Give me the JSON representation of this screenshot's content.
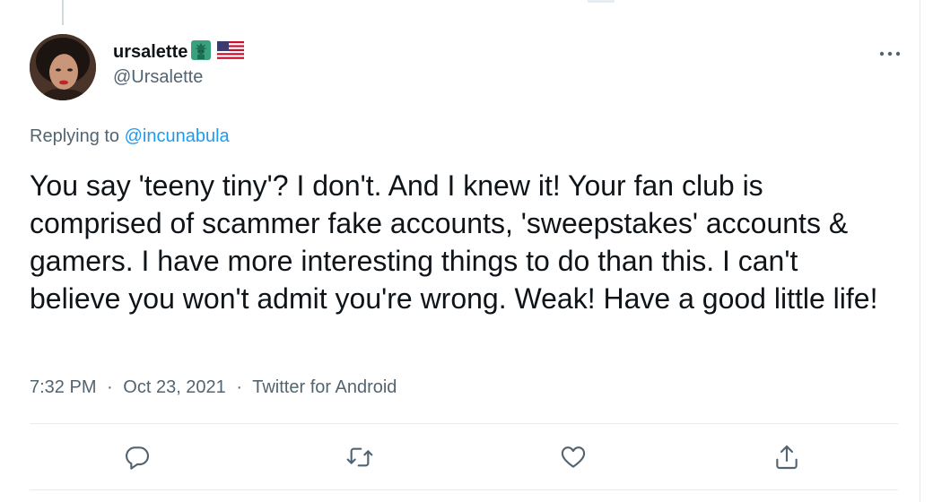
{
  "author": {
    "display_name": "ursalette",
    "handle": "@Ursalette",
    "badges": [
      "statue-of-liberty-emoji",
      "us-flag-emoji"
    ]
  },
  "reply": {
    "prefix": "Replying to",
    "mention": "@incunabula"
  },
  "tweet": {
    "text": "You say 'teeny tiny'? I don't. And I knew it! Your fan club is comprised of scammer fake accounts, 'sweepstakes' accounts & gamers. I have more interesting things to do than this. I can't believe you won't admit you're wrong. Weak! Have a good little life!"
  },
  "meta": {
    "time": "7:32 PM",
    "date": "Oct 23, 2021",
    "source": "Twitter for Android",
    "separator": "·"
  },
  "actions": [
    "reply-icon",
    "retweet-icon",
    "like-icon",
    "share-icon"
  ],
  "colors": {
    "text": "#0f1419",
    "secondary": "#536471",
    "link": "#1d9bf0",
    "divider": "#e6ecf0"
  }
}
